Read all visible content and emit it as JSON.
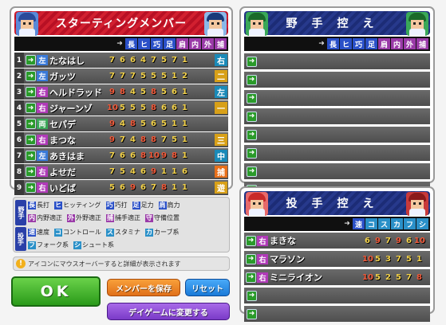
{
  "colors": {
    "accent_red": "#d22030",
    "accent_blue": "#27398c",
    "stat": "#f3d24b",
    "stat_high": "#f35a3a"
  },
  "lineup": {
    "title": "スターティングメンバー",
    "columns": [
      "長",
      "ヒ",
      "巧",
      "足",
      "肩",
      "内",
      "外",
      "捕"
    ],
    "col_colors": [
      "#2a50c8",
      "#2a50c8",
      "#2a50c8",
      "#2a50c8",
      "#9a3aa8",
      "#9a3aa8",
      "#9a3aa8",
      "#9a3aa8"
    ],
    "players": [
      {
        "no": "1",
        "hand": "左",
        "name": "たなはし",
        "stats": [
          "7",
          "6",
          "6",
          "4",
          "7",
          "5",
          "7",
          "1"
        ],
        "pos": "右",
        "pos_color": "#1a8ab8",
        "hand_color": "#3a7ad8"
      },
      {
        "no": "2",
        "hand": "左",
        "name": "ガッツ",
        "stats": [
          "7",
          "7",
          "7",
          "5",
          "5",
          "5",
          "1",
          "2"
        ],
        "pos": "二",
        "pos_color": "#d8a018",
        "hand_color": "#3a7ad8"
      },
      {
        "no": "3",
        "hand": "右",
        "name": "ヘルドラッド",
        "stats": [
          "9",
          "8",
          "4",
          "5",
          "8",
          "5",
          "6",
          "1"
        ],
        "pos": "左",
        "pos_color": "#1a8ab8",
        "hand_color": "#b03ab8"
      },
      {
        "no": "4",
        "hand": "右",
        "name": "ジャーンゾ",
        "stats": [
          "10",
          "5",
          "5",
          "5",
          "8",
          "6",
          "6",
          "1"
        ],
        "pos": "一",
        "pos_color": "#d8a018",
        "hand_color": "#b03ab8"
      },
      {
        "no": "5",
        "hand": "両",
        "name": "セパデ",
        "stats": [
          "9",
          "4",
          "8",
          "5",
          "6",
          "5",
          "1",
          "1"
        ],
        "pos": "",
        "pos_color": "",
        "hand_color": "#3aa858"
      },
      {
        "no": "6",
        "hand": "右",
        "name": "まつな",
        "stats": [
          "9",
          "7",
          "4",
          "8",
          "8",
          "7",
          "5",
          "1"
        ],
        "pos": "三",
        "pos_color": "#d8a018",
        "hand_color": "#b03ab8"
      },
      {
        "no": "7",
        "hand": "左",
        "name": "あきはま",
        "stats": [
          "7",
          "6",
          "6",
          "8",
          "10",
          "9",
          "8",
          "1"
        ],
        "pos": "中",
        "pos_color": "#1a8ab8",
        "hand_color": "#3a7ad8"
      },
      {
        "no": "8",
        "hand": "右",
        "name": "よせだ",
        "stats": [
          "7",
          "5",
          "4",
          "6",
          "9",
          "1",
          "1",
          "6"
        ],
        "pos": "捕",
        "pos_color": "#e8701a",
        "hand_color": "#b03ab8"
      },
      {
        "no": "9",
        "hand": "右",
        "name": "いどば",
        "stats": [
          "5",
          "6",
          "9",
          "6",
          "7",
          "8",
          "1",
          "1"
        ],
        "pos": "遊",
        "pos_color": "#d8a018",
        "hand_color": "#b03ab8"
      }
    ]
  },
  "bench": {
    "title": "野手控え",
    "columns": [
      "長",
      "ヒ",
      "巧",
      "足",
      "肩",
      "内",
      "外",
      "捕"
    ]
  },
  "bullpen": {
    "title": "投手控え",
    "columns": [
      "速",
      "コ",
      "ス",
      "カ",
      "フ",
      "シ"
    ],
    "pitchers": [
      {
        "hand": "右",
        "name": "まきな",
        "stats": [
          "6",
          "9",
          "7",
          "9",
          "6",
          "10"
        ]
      },
      {
        "hand": "右",
        "name": "マラソン",
        "stats": [
          "10",
          "5",
          "3",
          "7",
          "5",
          "1"
        ]
      },
      {
        "hand": "右",
        "name": "ミニライオン",
        "stats": [
          "10",
          "5",
          "2",
          "5",
          "7",
          "8"
        ]
      }
    ]
  },
  "legend": {
    "fielder_label": "野手",
    "pitcher_label": "投手",
    "row1": [
      {
        "k": "長",
        "t": "長打"
      },
      {
        "k": "ヒ",
        "t": "ヒッティング"
      },
      {
        "k": "巧",
        "t": "巧打"
      },
      {
        "k": "足",
        "t": "足力"
      },
      {
        "k": "肩",
        "t": "肩力"
      }
    ],
    "row2": [
      {
        "k": "内",
        "t": "内野適正"
      },
      {
        "k": "外",
        "t": "外野適正"
      },
      {
        "k": "捕",
        "t": "捕手適正"
      },
      {
        "k": "守",
        "t": "守備位置"
      }
    ],
    "row3": [
      {
        "k": "速",
        "t": "速度"
      },
      {
        "k": "コ",
        "t": "コントロール"
      },
      {
        "k": "ス",
        "t": "スタミナ"
      },
      {
        "k": "カ",
        "t": "カーブ系"
      }
    ],
    "row4": [
      {
        "k": "フ",
        "t": "フォーク系"
      },
      {
        "k": "シ",
        "t": "シュート系"
      }
    ]
  },
  "hint": "アイコンにマウスオーバーすると詳細が表示されます",
  "buttons": {
    "ok": "OK",
    "save": "メンバーを保存",
    "reset": "リセット",
    "day": "デイゲームに変更する"
  }
}
